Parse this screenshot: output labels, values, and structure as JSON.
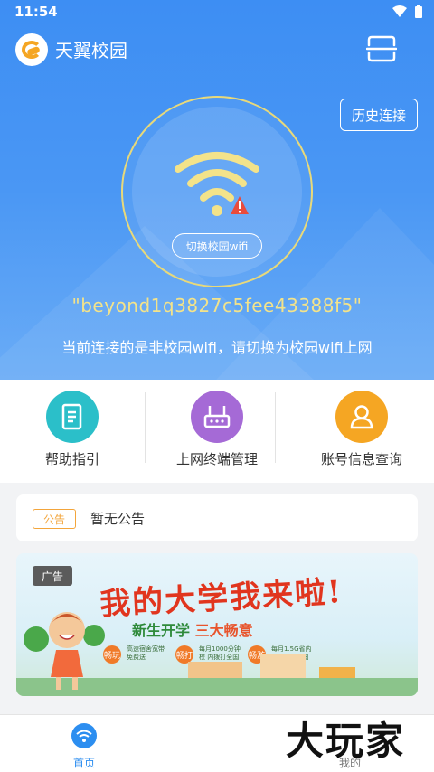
{
  "status_bar": {
    "time": "11:54"
  },
  "app": {
    "title": "天翼校园"
  },
  "header": {
    "history_label": "历史连接"
  },
  "connection": {
    "switch_label": "切换校园wifi",
    "ssid": "\"beyond1q3827c5fee43388f5\"",
    "hint": "当前连接的是非校园wifi，请切换为校园wifi上网"
  },
  "actions": [
    {
      "label": "帮助指引",
      "color": "#2bbfc9",
      "icon": "document-icon"
    },
    {
      "label": "上网终端管理",
      "color": "#a56ad6",
      "icon": "router-icon"
    },
    {
      "label": "账号信息查询",
      "color": "#f5a623",
      "icon": "user-icon"
    }
  ],
  "notice": {
    "tag": "公告",
    "text": "暂无公告"
  },
  "ad": {
    "tag": "广告",
    "headline": "我的大学我来啦!",
    "sub_prefix": "新生开学 ",
    "sub_highlight": "三大畅意",
    "badges": [
      {
        "label": "畅玩",
        "text": "高速宿舍宽带 免费送"
      },
      {
        "label": "畅打",
        "text": "每月1000分钟校 内拨打全国电话"
      },
      {
        "label": "畅游",
        "text": "每月1.5G省内+500M 全国超大4G套餐"
      }
    ]
  },
  "tabs": [
    {
      "label": "首页",
      "active": true
    },
    {
      "label": "我的",
      "active": false
    }
  ],
  "watermark": "大玩家",
  "colors": {
    "primary": "#3d8ef3",
    "accent_yellow": "#f3e38a",
    "tab_active": "#2c8ef0"
  }
}
